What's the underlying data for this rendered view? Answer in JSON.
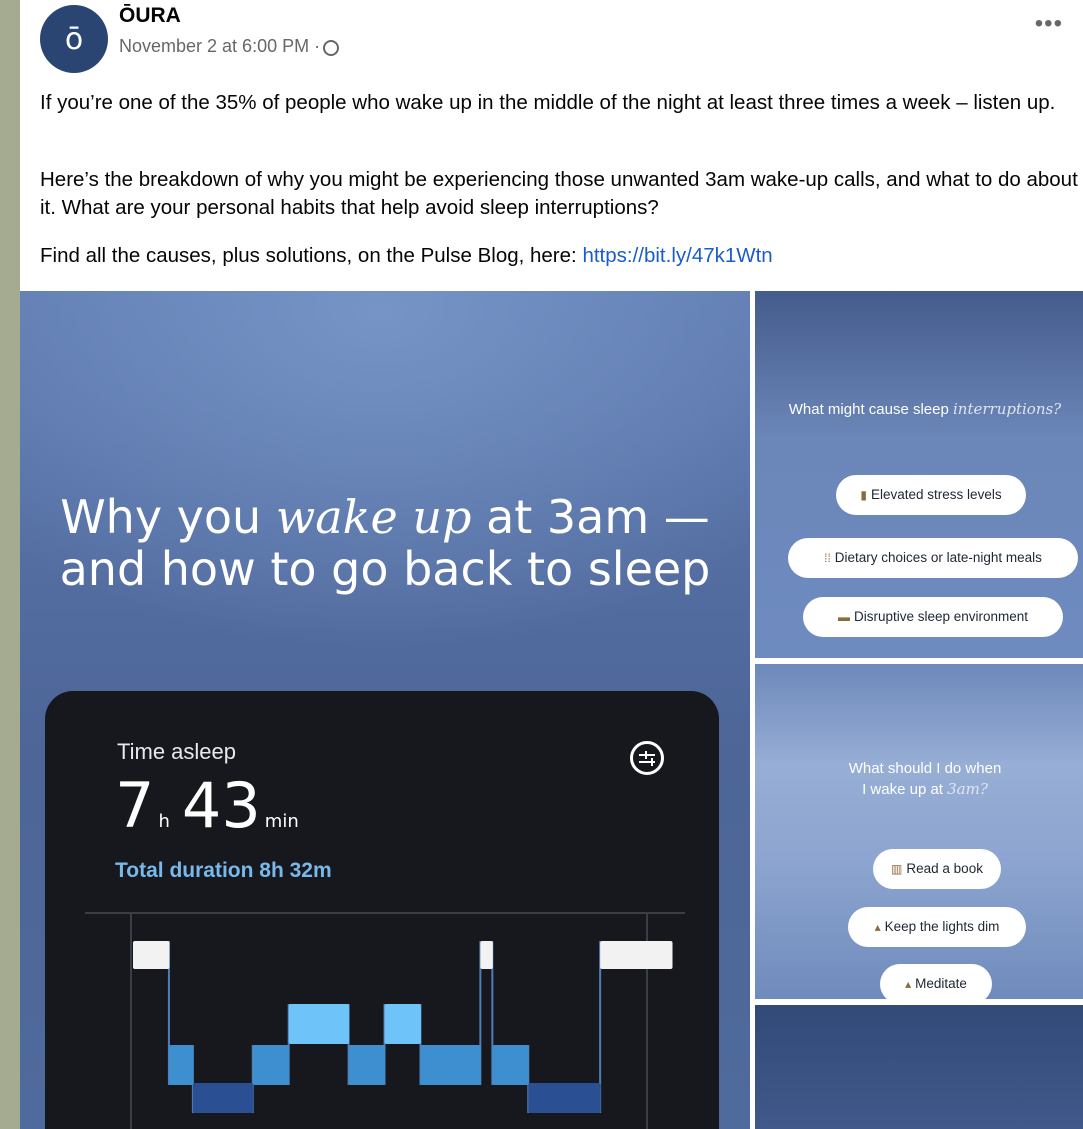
{
  "post": {
    "avatar_letter": "ō",
    "page_name": "ŌURA",
    "timestamp": "November 2 at 6:00 PM ·",
    "privacy_icon": "globe-icon",
    "more_icon": "•••",
    "paragraph1": "If you’re one of the 35% of people who wake up in the middle of the night at least three times a week – listen up.",
    "paragraph2": "Here’s the breakdown of why you might be experiencing those unwanted 3am wake-up calls, and what to do about it. What are your personal habits that help avoid sleep interruptions?",
    "paragraph3_prefix": "Find all the causes, plus solutions, on the Pulse Blog, here:",
    "link": "https://bit.ly/47k1Wtn"
  },
  "main_image": {
    "headline_part1": "Why you",
    "headline_italic": "wake up",
    "headline_part2": "at 3am —",
    "headline_line2": "and how to go back to sleep",
    "card": {
      "label": "Time asleep",
      "hours": "7",
      "hours_unit": "h",
      "minutes": "43",
      "minutes_unit": "min",
      "total": "Total duration 8h 32m"
    },
    "hypnogram": {
      "stages": [
        "awake",
        "rem",
        "light",
        "deep"
      ],
      "stage_colors": {
        "awake": "#f2f2f2",
        "rem": "#6ec3f8",
        "light": "#3e8fd0",
        "deep": "#2a4f92"
      },
      "segments": [
        {
          "stage": "awake",
          "duration": 3
        },
        {
          "stage": "light",
          "duration": 2
        },
        {
          "stage": "deep",
          "duration": 5
        },
        {
          "stage": "light",
          "duration": 3
        },
        {
          "stage": "rem",
          "duration": 5
        },
        {
          "stage": "light",
          "duration": 3
        },
        {
          "stage": "rem",
          "duration": 3
        },
        {
          "stage": "light",
          "duration": 5
        },
        {
          "stage": "awake",
          "duration": 1
        },
        {
          "stage": "light",
          "duration": 3
        },
        {
          "stage": "deep",
          "duration": 6
        },
        {
          "stage": "awake",
          "duration": 6
        }
      ]
    }
  },
  "side1": {
    "heading_prefix": "What might cause sleep",
    "heading_italic": "interruptions?",
    "pills": [
      {
        "icon": "▮",
        "label": "Elevated stress levels"
      },
      {
        "icon": "⁞⁞",
        "label": "Dietary choices or late-night meals"
      },
      {
        "icon": "▬",
        "label": "Disruptive sleep environment"
      }
    ]
  },
  "side2": {
    "heading_line1": "What should I do when",
    "heading_line2_prefix": "I wake up at",
    "heading_italic": "3am?",
    "pills": [
      {
        "icon": "▥",
        "label": "Read a book"
      },
      {
        "icon": "▴",
        "label": "Keep the lights dim"
      },
      {
        "icon": "▴",
        "label": "Meditate"
      }
    ]
  }
}
